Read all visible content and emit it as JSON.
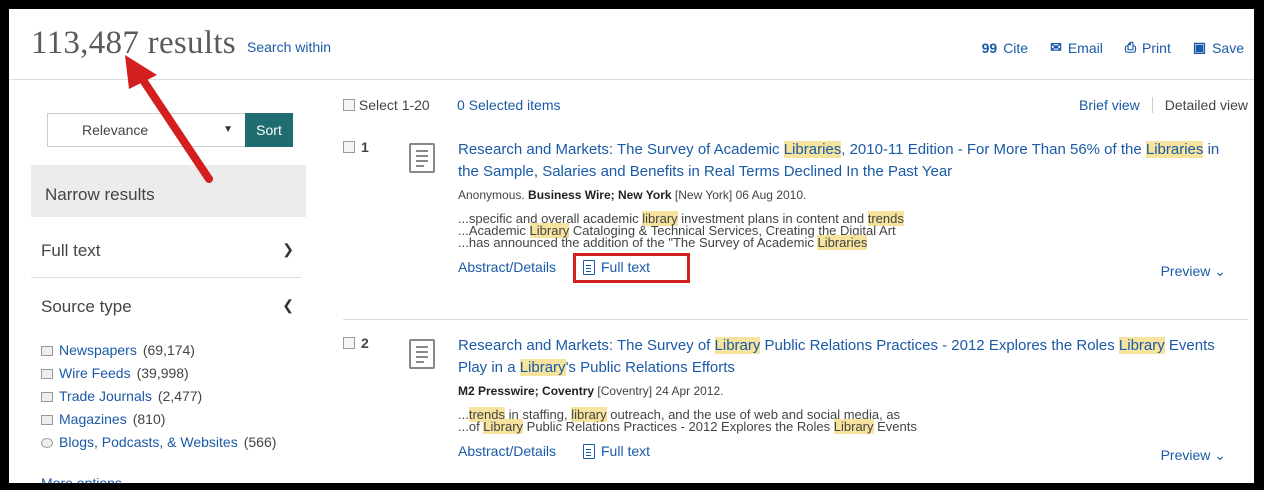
{
  "header": {
    "results_count": "113,487 results",
    "search_within": "Search within",
    "tools": [
      {
        "icon": "quote-icon",
        "glyph": "99",
        "label": "Cite"
      },
      {
        "icon": "envelope-icon",
        "glyph": "✉",
        "label": "Email"
      },
      {
        "icon": "printer-icon",
        "glyph": "⎙",
        "label": "Print"
      },
      {
        "icon": "save-icon",
        "glyph": "▣",
        "label": "Save"
      }
    ]
  },
  "sort": {
    "selected": "Relevance",
    "button": "Sort"
  },
  "narrow": {
    "label": "Narrow results"
  },
  "facets": {
    "full_text": {
      "label": "Full text",
      "chevron": "⌄"
    },
    "source_type": {
      "label": "Source type",
      "chevron": "⌃"
    },
    "items": [
      {
        "label": "Newspapers",
        "count": "(69,174)"
      },
      {
        "label": "Wire Feeds",
        "count": "(39,998)"
      },
      {
        "label": "Trade Journals",
        "count": "(2,477)"
      },
      {
        "label": "Magazines",
        "count": "(810)"
      },
      {
        "label": "Blogs, Podcasts, & Websites",
        "count": "(566)"
      }
    ],
    "more_options": "More options"
  },
  "results_header": {
    "select_label": "Select 1-20",
    "selected_items": "0 Selected items",
    "brief_view": "Brief view",
    "detailed_view": "Detailed view"
  },
  "results": [
    {
      "number": "1",
      "title_parts": [
        "Research and Markets: The Survey of Academic ",
        "Libraries",
        ", 2010-11 Edition - For More Than 56% of the ",
        "Libraries",
        " in the Sample, Salaries and Benefits in Real Terms Declined In the Past Year"
      ],
      "meta_author": "Anonymous.",
      "meta_source": "Business Wire; New York",
      "meta_rest": "[New York] 06 Aug 2010.",
      "snippets": [
        [
          "...specific and overall academic ",
          "library",
          " investment plans in content and ",
          "trends"
        ],
        [
          "...Academic ",
          "Library",
          " Cataloging & Technical Services, Creating the Digital Art"
        ],
        [
          "...has announced the addition of the \"The Survey of Academic ",
          "Libraries"
        ]
      ],
      "abstract_link": "Abstract/Details",
      "fulltext_link": "Full text",
      "preview": "Preview ⌄"
    },
    {
      "number": "2",
      "title_parts": [
        "Research and Markets: The Survey of ",
        "Library",
        " Public Relations Practices - 2012 Explores the Roles ",
        "Library",
        " Events Play in a ",
        "Library",
        "'s Public Relations Efforts"
      ],
      "meta_author": "",
      "meta_source": "M2 Presswire; Coventry",
      "meta_rest": "[Coventry] 24 Apr 2012.",
      "snippets": [
        [
          "...",
          "trends",
          " in staffing, ",
          "library",
          " outreach, and the use of web and social media, as"
        ],
        [
          "...of ",
          "Library",
          " Public Relations Practices - 2012 Explores the Roles ",
          "Library",
          " Events"
        ]
      ],
      "abstract_link": "Abstract/Details",
      "fulltext_link": "Full text",
      "preview": "Preview ⌄"
    }
  ]
}
